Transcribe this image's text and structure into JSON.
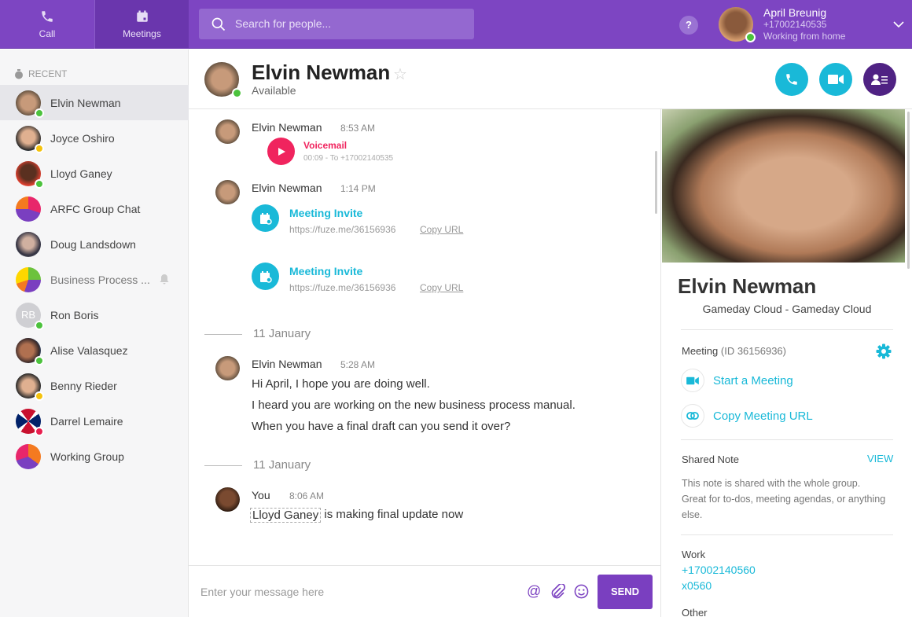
{
  "topbar": {
    "tabs": [
      {
        "label": "Call",
        "icon": "phone-icon"
      },
      {
        "label": "Meetings",
        "icon": "calendar-icon"
      }
    ],
    "search_placeholder": "Search for people...",
    "help": "?",
    "user": {
      "name": "April Breunig",
      "phone": "+17002140535",
      "status": "Working from home"
    }
  },
  "colors": {
    "brand": "#7d45c2",
    "accent": "#19b9d8",
    "voicemail": "#f0245e",
    "online": "#4cc23d",
    "away": "#f4c20d",
    "dnd": "#e91e4f"
  },
  "sidebar": {
    "section": "RECENT",
    "items": [
      {
        "name": "Elvin Newman",
        "status": "online"
      },
      {
        "name": "Joyce Oshiro",
        "status": "away"
      },
      {
        "name": "Lloyd Ganey",
        "status": "online"
      },
      {
        "name": "ARFC Group Chat"
      },
      {
        "name": "Doug Landsdown"
      },
      {
        "name": "Business Process ...",
        "muted": true
      },
      {
        "name": "Ron Boris",
        "initials": "RB",
        "status": "online"
      },
      {
        "name": "Alise Valasquez",
        "status": "online"
      },
      {
        "name": "Benny Rieder",
        "status": "away"
      },
      {
        "name": "Darrel Lemaire",
        "status": "dnd"
      },
      {
        "name": "Working Group"
      }
    ]
  },
  "header": {
    "name": "Elvin Newman",
    "status": "Available"
  },
  "chat": {
    "m1": {
      "sender": "Elvin Newman",
      "time": "8:53 AM",
      "title": "Voicemail",
      "detail": "00:09 - To +17002140535"
    },
    "m2": {
      "sender": "Elvin Newman",
      "time": "1:14 PM",
      "invites": [
        {
          "title": "Meeting Invite",
          "url": "https://fuze.me/36156936",
          "copy": "Copy URL"
        },
        {
          "title": "Meeting Invite",
          "url": "https://fuze.me/36156936",
          "copy": "Copy URL"
        }
      ]
    },
    "date1": "11 January",
    "m3": {
      "sender": "Elvin Newman",
      "time": "5:28 AM",
      "lines": [
        "Hi April, I hope you are doing well.",
        "I heard you are working on the new business process manual.",
        "When you have a final draft can you send it over?"
      ]
    },
    "date2": "11 January",
    "m4": {
      "sender": "You",
      "time": "8:06 AM",
      "mention": "Lloyd Ganey",
      "text": " is making final update now"
    },
    "input_placeholder": "Enter your message here",
    "send": "SEND"
  },
  "panel": {
    "name": "Elvin Newman",
    "org": "Gameday Cloud - Gameday Cloud",
    "meeting_label": "Meeting",
    "meeting_id": "(ID 36156936)",
    "start": "Start a Meeting",
    "copy": "Copy Meeting URL",
    "note_label": "Shared Note",
    "note_view": "VIEW",
    "note_text": "This note is shared with the whole group. Great for to-dos, meeting agendas, or anything else.",
    "work_label": "Work",
    "work_phone": "+17002140560",
    "work_ext": "x0560",
    "other_label": "Other"
  }
}
